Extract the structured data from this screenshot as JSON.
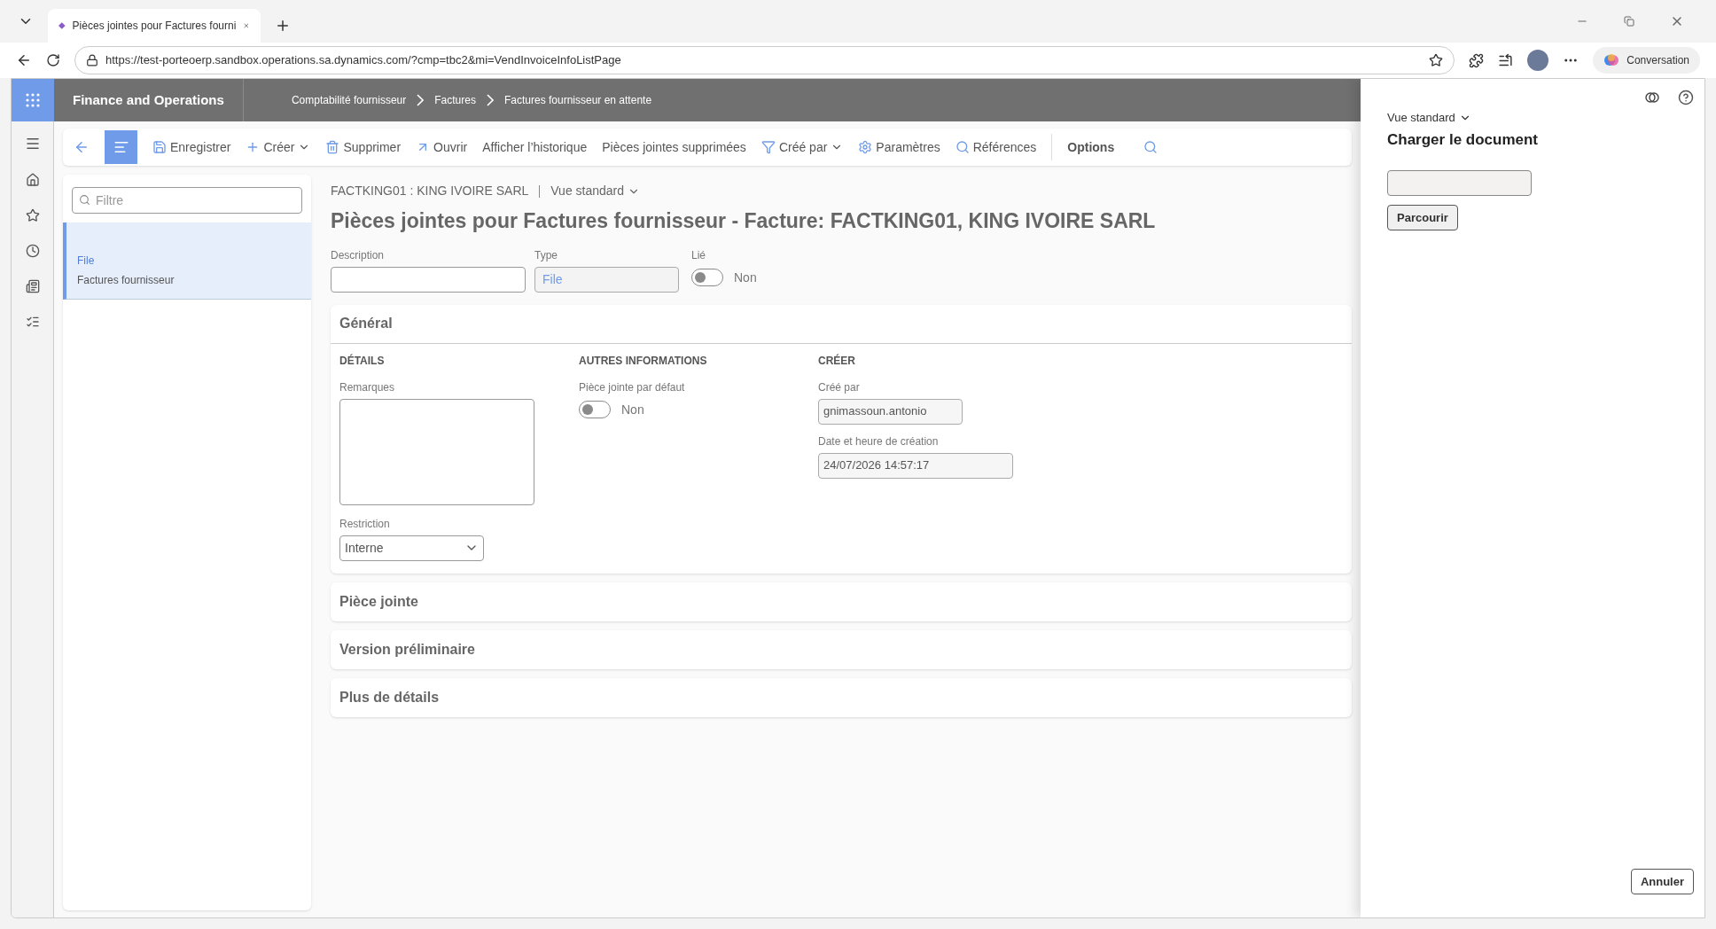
{
  "browser": {
    "tab_title": "Pièces jointes pour Factures fourni",
    "url": "https://test-porteoerp.sandbox.operations.sa.dynamics.com/?cmp=tbc2&mi=VendInvoiceInfoListPage",
    "copilot_label": "Conversation"
  },
  "app": {
    "title": "Finance and Operations",
    "breadcrumb": [
      "Comptabilité fournisseur",
      "Factures",
      "Factures fournisseur en attente"
    ]
  },
  "toolbar": {
    "list_pane_on": true,
    "items": [
      {
        "label": "Enregistrer",
        "kind": "save",
        "dropdown": false
      },
      {
        "label": "Créer",
        "kind": "create",
        "dropdown": true
      },
      {
        "label": "Supprimer",
        "kind": "delete",
        "dropdown": false
      },
      {
        "label": "Ouvrir",
        "kind": "open",
        "dropdown": false
      },
      {
        "label": "Afficher l’historique",
        "kind": "text",
        "dropdown": false
      },
      {
        "label": "Pièces jointes supprimées",
        "kind": "text",
        "dropdown": false
      },
      {
        "label": "Créé par",
        "kind": "filter",
        "dropdown": true
      },
      {
        "label": "Paramètres",
        "kind": "settings",
        "dropdown": false
      },
      {
        "label": "Références",
        "kind": "search",
        "dropdown": false
      }
    ],
    "options_label": "Options"
  },
  "list": {
    "filter_placeholder": "Filtre",
    "items": [
      {
        "type": "File",
        "name": "Factures fournisseur",
        "selected": true
      }
    ]
  },
  "form": {
    "caption": "FACTKING01 : KING IVOIRE SARL",
    "view": "Vue standard",
    "title": "Pièces jointes pour Factures fournisseur - Facture: FACTKING01, KING IVOIRE SARL",
    "description": {
      "label": "Description"
    },
    "type": {
      "label": "Type",
      "value": "File"
    },
    "linked": {
      "label": "Lié",
      "on": false,
      "text": "Non"
    }
  },
  "sections": [
    {
      "title": "Général",
      "expanded": true,
      "details": {
        "heading": "DÉTAILS",
        "remarks_label": "Remarques",
        "restriction_label": "Restriction",
        "restriction_value": "Interne"
      },
      "other": {
        "heading": "AUTRES INFORMATIONS",
        "default_label": "Pièce jointe par défaut",
        "default_on": false,
        "default_text": "Non"
      },
      "create": {
        "heading": "CRÉER",
        "created_by_label": "Créé par",
        "created_by": "gnimassoun.antonio",
        "created_at_label": "Date et heure de création",
        "created_at": "24/07/2026 14:57:17"
      }
    },
    {
      "title": "Pièce jointe",
      "expanded": false
    },
    {
      "title": "Version préliminaire",
      "expanded": false
    },
    {
      "title": "Plus de détails",
      "expanded": false
    }
  ],
  "panel": {
    "view": "Vue standard",
    "title": "Charger le document",
    "browse": "Parcourir",
    "cancel": "Annuler"
  }
}
